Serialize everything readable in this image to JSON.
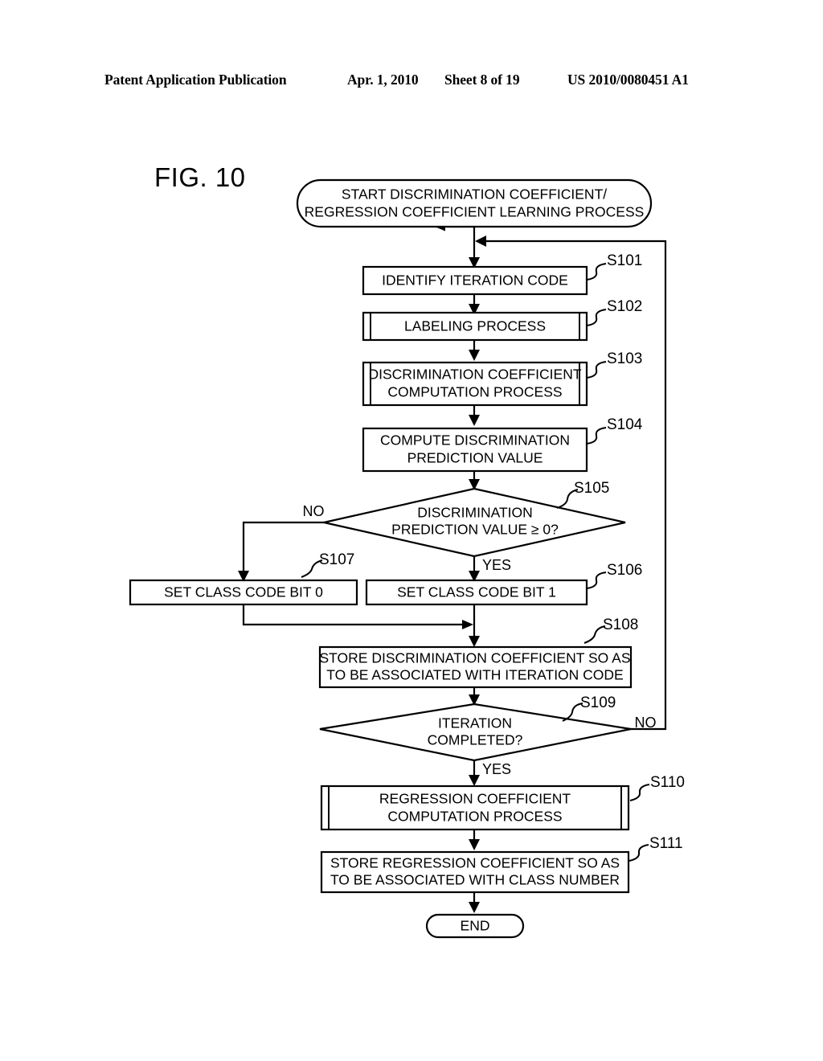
{
  "header": {
    "publication": "Patent Application Publication",
    "date": "Apr. 1, 2010",
    "sheet": "Sheet 8 of 19",
    "patent_number": "US 2010/0080451 A1"
  },
  "figure": {
    "title": "FIG. 10"
  },
  "flowchart": {
    "start": {
      "id": "start",
      "shape": "terminator",
      "line1": "START DISCRIMINATION COEFFICIENT/",
      "line2": "REGRESSION COEFFICIENT LEARNING PROCESS"
    },
    "end": {
      "id": "end",
      "shape": "terminator",
      "label": "END"
    },
    "steps": [
      {
        "step": "S101",
        "shape": "process",
        "line1": "IDENTIFY ITERATION CODE",
        "line2": ""
      },
      {
        "step": "S102",
        "shape": "predefined-process",
        "line1": "LABELING PROCESS",
        "line2": ""
      },
      {
        "step": "S103",
        "shape": "predefined-process",
        "line1": "DISCRIMINATION COEFFICIENT",
        "line2": "COMPUTATION PROCESS"
      },
      {
        "step": "S104",
        "shape": "process",
        "line1": "COMPUTE DISCRIMINATION",
        "line2": "PREDICTION VALUE"
      },
      {
        "step": "S105",
        "shape": "decision",
        "line1": "DISCRIMINATION",
        "line2": "PREDICTION VALUE ≥ 0?"
      },
      {
        "step": "S106",
        "shape": "process",
        "line1": "SET CLASS CODE BIT 1",
        "line2": ""
      },
      {
        "step": "S107",
        "shape": "process",
        "line1": "SET CLASS CODE BIT 0",
        "line2": ""
      },
      {
        "step": "S108",
        "shape": "process",
        "line1": "STORE DISCRIMINATION COEFFICIENT SO AS",
        "line2": "TO BE ASSOCIATED WITH ITERATION CODE"
      },
      {
        "step": "S109",
        "shape": "decision",
        "line1": "ITERATION",
        "line2": "COMPLETED?"
      },
      {
        "step": "S110",
        "shape": "predefined-process",
        "line1": "REGRESSION COEFFICIENT",
        "line2": "COMPUTATION PROCESS"
      },
      {
        "step": "S111",
        "shape": "process",
        "line1": "STORE REGRESSION COEFFICIENT SO AS",
        "line2": "TO BE ASSOCIATED WITH CLASS NUMBER"
      }
    ],
    "branch_labels": {
      "s105_no": "NO",
      "s105_yes": "YES",
      "s109_no": "NO",
      "s109_yes": "YES"
    }
  }
}
